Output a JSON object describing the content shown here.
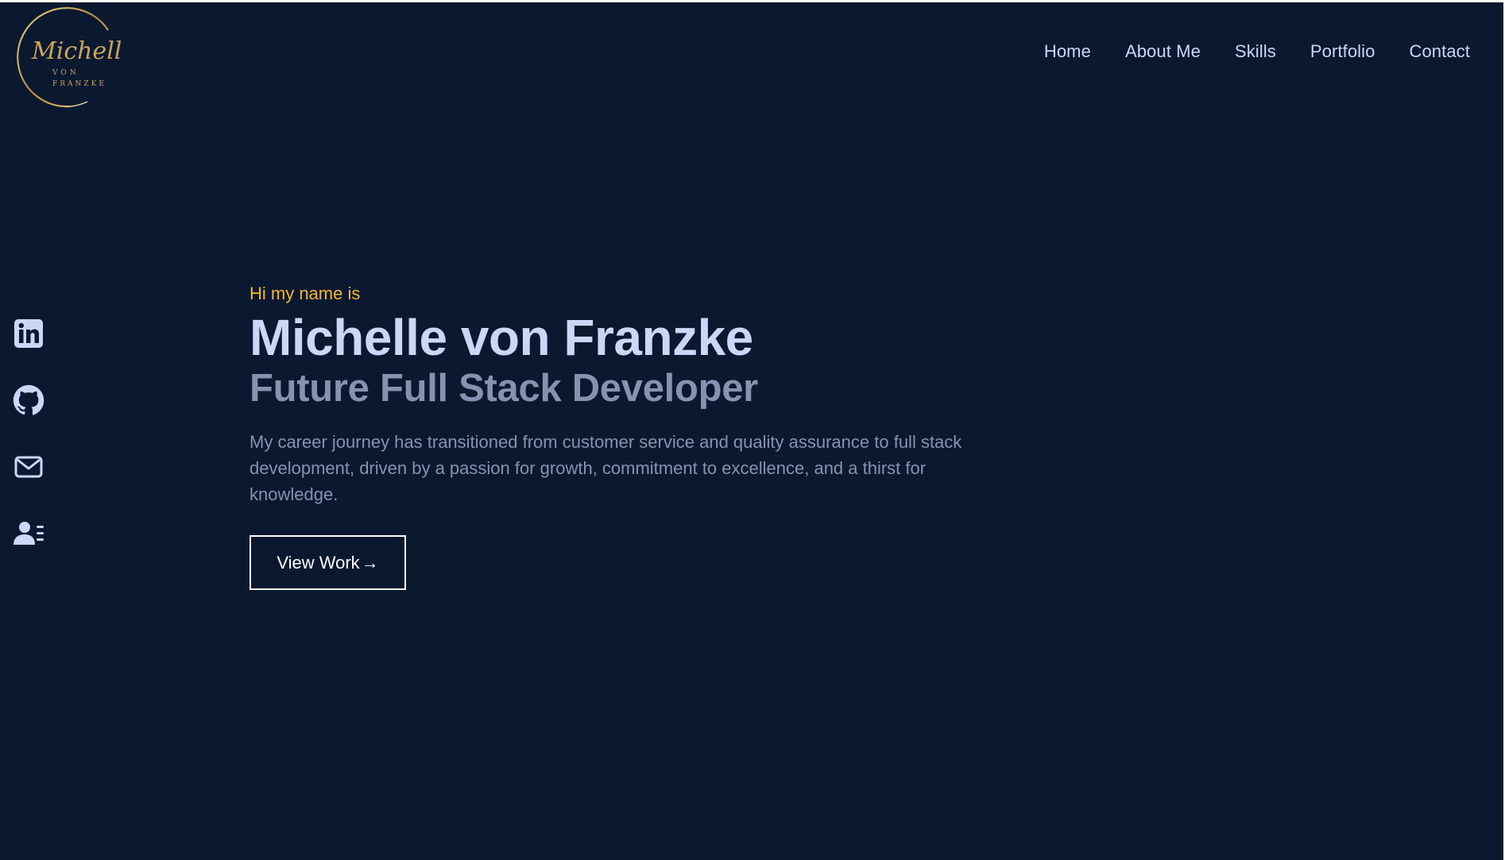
{
  "logo": {
    "script": "Michelle",
    "small_1": "VON",
    "small_2": "FRANZKE"
  },
  "nav": {
    "items": [
      {
        "label": "Home"
      },
      {
        "label": "About Me"
      },
      {
        "label": "Skills"
      },
      {
        "label": "Portfolio"
      },
      {
        "label": "Contact"
      }
    ]
  },
  "social": {
    "icons": [
      "linkedin-icon",
      "github-icon",
      "mail-icon",
      "resume-icon"
    ]
  },
  "hero": {
    "greeting": "Hi my name is",
    "name": "Michelle von Franzke",
    "role": "Future Full Stack Developer",
    "description": "My career journey has transitioned from customer service and quality assurance to full stack development, driven by a passion for growth, commitment to excellence, and a thirst for knowledge.",
    "cta_label": "View Work",
    "cta_arrow": "→"
  },
  "colors": {
    "background": "#0a192f",
    "heading": "#ccd6f6",
    "muted": "#8892b0",
    "accent": "#f5b530",
    "logo_gold": "#c9a45c"
  }
}
